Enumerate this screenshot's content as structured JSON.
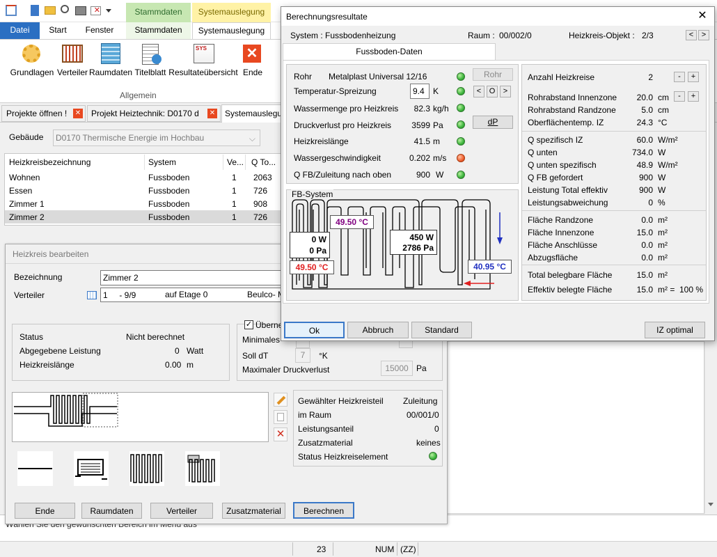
{
  "app": {
    "qat_icons": [
      "home-icon",
      "document-icon",
      "folder-icon",
      "search-icon",
      "print-icon",
      "close-doc-icon",
      "dropdown-icon"
    ],
    "ctx_tabs": [
      "Stammdaten",
      "Systemauslegung"
    ],
    "ribbon_tabs": [
      "Datei",
      "Start",
      "Fenster",
      "Stammdaten",
      "Systemauslegung"
    ],
    "ribbon_buttons": [
      "Grundlagen",
      "Verteiler",
      "Raumdaten",
      "Titelblatt",
      "Resultateübersicht",
      "Ende"
    ],
    "ribbon_group": "Allgemein",
    "doc_tabs": [
      "Projekte öffnen !",
      "Projekt Heiztechnik: D0170 d",
      "Systemauslegu"
    ],
    "gebaeude_label": "Gebäude",
    "gebaeude_value": "D0170 Thermische Energie im Hochbau",
    "table_headers": [
      "Heizkreisbezeichnung",
      "System",
      "Ve...",
      "Q To..."
    ],
    "table_rows": [
      [
        "Wohnen",
        "Fussboden",
        "1",
        "2063"
      ],
      [
        "Essen",
        "Fussboden",
        "1",
        "726"
      ],
      [
        "Zimmer 1",
        "Fussboden",
        "1",
        "908"
      ],
      [
        "Zimmer 2",
        "Fussboden",
        "1",
        "726"
      ]
    ],
    "status_text": "Wählen Sie den gewünschten Bereich im Menü aus",
    "statusbar": [
      "23",
      "NUM",
      "(ZZ)"
    ],
    "sys": "SYS"
  },
  "hk": {
    "title": "Heizkreis bearbeiten",
    "bezeichnung_label": "Bezeichnung",
    "bezeichnung_value": "Zimmer 2",
    "verteiler_label": "Verteiler",
    "verteiler_value": "1     - 9/9",
    "etage": "auf Etage 0",
    "verteiler_extra": "Beulco- M",
    "status_label": "Status",
    "status_value": "Nicht berechnet",
    "leistung_label": "Abgegebene Leistung",
    "leistung_value": "0",
    "leistung_unit": "Watt",
    "laenge_label": "Heizkreislänge",
    "laenge_value": "0.00",
    "laenge_unit": "m",
    "uebern": "Überne",
    "minimales": "Minimales",
    "soll_label": "Soll dT",
    "soll_value": "7",
    "soll_unit": "°K",
    "maxdruck_label": "Maximaler Druckverlust",
    "maxdruck_value": "15000",
    "maxdruck_unit": "Pa",
    "info": [
      [
        "Gewählter Heizkreisteil",
        "Zuleitung"
      ],
      [
        "im Raum",
        "00/001/0"
      ],
      [
        "Leistungsanteil",
        "0"
      ],
      [
        "Zusatzmaterial",
        "keines"
      ],
      [
        "Status Heizkreiselement",
        ""
      ]
    ],
    "buttons": [
      "Ende",
      "Raumdaten",
      "Verteiler",
      "Zusatzmaterial",
      "Berechnen"
    ]
  },
  "dlg": {
    "title": "Berechnungsresultate",
    "close": "✕",
    "system_label": "System :",
    "system_value": "Fussbodenheizung",
    "raum_label": "Raum :",
    "raum_value": "00/002/0",
    "objekt_label": "Heizkreis-Objekt :",
    "objekt_value": "2/3",
    "tab": "Fussboden-Daten",
    "left_rows": [
      {
        "label": "Rohr",
        "value": "Metalplast Universal 12/16",
        "unit": "",
        "status": "ok"
      },
      {
        "label": "Temperatur-Spreizung",
        "value": "9.4",
        "unit": "K",
        "status": "ok"
      },
      {
        "label": "Wassermenge pro Heizkreis",
        "value": "82.3",
        "unit": "kg/h",
        "status": "ok"
      },
      {
        "label": "Druckverlust pro Heizkreis",
        "value": "3599",
        "unit": "Pa",
        "status": "ok"
      },
      {
        "label": "Heizkreislänge",
        "value": "41.5",
        "unit": "m",
        "status": "ok"
      },
      {
        "label": "Wassergeschwindigkeit",
        "value": "0.202",
        "unit": "m/s",
        "status": "warn"
      },
      {
        "label": "Q FB/Zuleitung nach oben",
        "value": "900",
        "unit": "W",
        "status": "ok"
      }
    ],
    "rohr_btn": "Rohr",
    "nav": [
      "<",
      "O",
      ">"
    ],
    "dp_btn": "dP",
    "fb_label": "FB-System",
    "diagram": {
      "temp1": "49.50 °C",
      "temp2": "49.50 °C",
      "temp3": "40.95 °C",
      "box1_l1": "0 W",
      "box1_l2": "0 Pa",
      "box2_l1": "450 W",
      "box2_l2": "2786 Pa"
    },
    "right_rows": [
      {
        "label": "Anzahl Heizkreise",
        "value": "2",
        "unit": ""
      },
      {
        "label": "Rohrabstand Innenzone",
        "value": "20.0",
        "unit": "cm"
      },
      {
        "label": "Rohrabstand Randzone",
        "value": "5.0",
        "unit": "cm"
      },
      {
        "label": "Oberflächentemp. IZ",
        "value": "24.3",
        "unit": "°C"
      },
      {
        "label": "Q spezifisch IZ",
        "value": "60.0",
        "unit": "W/m²"
      },
      {
        "label": "Q unten",
        "value": "734.0",
        "unit": "W"
      },
      {
        "label": "Q unten spezifisch",
        "value": "48.9",
        "unit": "W/m²"
      },
      {
        "label": "Q FB gefordert",
        "value": "900",
        "unit": "W"
      },
      {
        "label": "Leistung Total effektiv",
        "value": "900",
        "unit": "W"
      },
      {
        "label": "Leistungsabweichung",
        "value": "0",
        "unit": "%"
      },
      {
        "label": "Fläche Randzone",
        "value": "0.0",
        "unit": "m²"
      },
      {
        "label": "Fläche Innenzone",
        "value": "15.0",
        "unit": "m²"
      },
      {
        "label": "Fläche Anschlüsse",
        "value": "0.0",
        "unit": "m²"
      },
      {
        "label": "Abzugsfläche",
        "value": "0.0",
        "unit": "m²"
      },
      {
        "label": "Total belegbare Fläche",
        "value": "15.0",
        "unit": "m²"
      },
      {
        "label": "Effektiv belegte Fläche",
        "value": "15.0",
        "unit": "m² =",
        "extra": "100 %"
      }
    ],
    "buttons": [
      "Ok",
      "Abbruch",
      "Standard",
      "IZ optimal"
    ]
  }
}
